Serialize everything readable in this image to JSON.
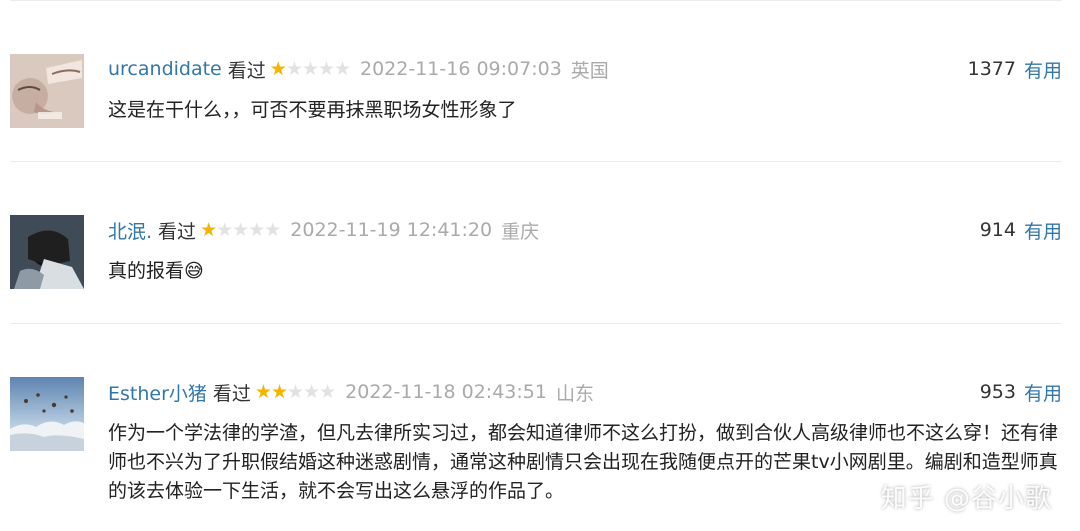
{
  "comments": [
    {
      "username": "urcandidate",
      "watched": "看过",
      "stars": 1,
      "time": "2022-11-16 09:07:03",
      "location": "英国",
      "votes": "1377",
      "useful": "有用",
      "text": "这是在干什么，，可否不要再抹黑职场女性形象了"
    },
    {
      "username": "北泯.",
      "watched": "看过",
      "stars": 1,
      "time": "2022-11-19 12:41:20",
      "location": "重庆",
      "votes": "914",
      "useful": "有用",
      "text": "真的报看😅"
    },
    {
      "username": "Esther小猪",
      "watched": "看过",
      "stars": 2,
      "time": "2022-11-18 02:43:51",
      "location": "山东",
      "votes": "953",
      "useful": "有用",
      "text": "作为一个学法律的学渣，但凡去律所实习过，都会知道律师不这么打扮，做到合伙人高级律师也不这么穿！还有律师也不兴为了升职假结婚这种迷惑剧情，通常这种剧情只会出现在我随便点开的芒果tv小网剧里。编剧和造型师真的该去体验一下生活，就不会写出这么悬浮的作品了。"
    }
  ],
  "watermark": "知乎 @谷小歌",
  "colors": {
    "link": "#3377aa",
    "star_on": "#f4b400",
    "star_off": "#e2e2e2",
    "meta_gray": "#aaaaaa",
    "divider": "#ececec"
  }
}
